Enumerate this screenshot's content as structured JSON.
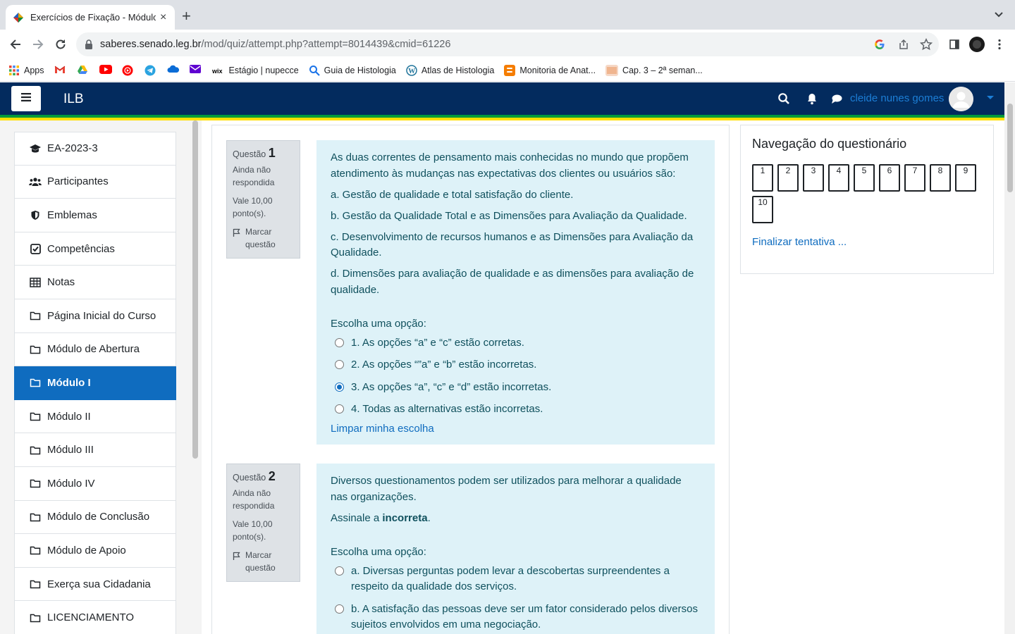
{
  "browser": {
    "tab_title": "Exercícios de Fixação - Módulo I",
    "tab_close": "×",
    "new_tab": "+",
    "url_host": "saberes.senado.leg.br",
    "url_path": "/mod/quiz/attempt.php?attempt=8014439&cmid=61226"
  },
  "bookmarks": {
    "apps": "Apps",
    "estagio": "Estágio | nupecce",
    "guia": "Guia de Histologia",
    "atlas": "Atlas de Histologia",
    "monitoria": "Monitoria de Anat...",
    "cap": "Cap. 3 – 2ª seman..."
  },
  "navbar": {
    "brand": "ILB",
    "username": "cleide nunes gomes"
  },
  "drawer": {
    "items": [
      {
        "label": "EA-2023-3",
        "icon": "graduation-cap-icon"
      },
      {
        "label": "Participantes",
        "icon": "users-icon"
      },
      {
        "label": "Emblemas",
        "icon": "shield-icon"
      },
      {
        "label": "Competências",
        "icon": "check-square-icon"
      },
      {
        "label": "Notas",
        "icon": "table-icon"
      },
      {
        "label": "Página Inicial do Curso",
        "icon": "folder-icon"
      },
      {
        "label": "Módulo de Abertura",
        "icon": "folder-icon"
      },
      {
        "label": "Módulo I",
        "icon": "folder-icon",
        "active": true
      },
      {
        "label": "Módulo II",
        "icon": "folder-icon"
      },
      {
        "label": "Módulo III",
        "icon": "folder-icon"
      },
      {
        "label": "Módulo IV",
        "icon": "folder-icon"
      },
      {
        "label": "Módulo de Conclusão",
        "icon": "folder-icon"
      },
      {
        "label": "Módulo de Apoio",
        "icon": "folder-icon"
      },
      {
        "label": "Exerça sua Cidadania",
        "icon": "folder-icon"
      },
      {
        "label": "LICENCIAMENTO",
        "icon": "folder-icon"
      }
    ]
  },
  "questions": [
    {
      "label": "Questão",
      "number": "1",
      "state": "Ainda não respondida",
      "grade": "Vale 10,00 ponto(s).",
      "flag": "Marcar questão",
      "text": "As duas correntes de pensamento mais conhecidas no mundo que propõem atendimento às mudanças nas expectativas dos clientes ou usuários são:",
      "statements": [
        "a. Gestão de qualidade e total satisfação do cliente.",
        "b. Gestão da Qualidade Total e as Dimensões para Avaliação da Qualidade.",
        "c. Desenvolvimento de recursos humanos e as Dimensões para Avaliação da Qualidade.",
        "d. Dimensões para avaliação de qualidade e as dimensões para avaliação de qualidade."
      ],
      "prompt": "Escolha uma opção:",
      "options": [
        {
          "text": "1. As opções “a” e “c” estão corretas.",
          "checked": false
        },
        {
          "text": "2. As opções “”a” e “b” estão incorretas.",
          "checked": false
        },
        {
          "text": "3. As opções “a”, “c” e “d” estão incorretas.",
          "checked": true
        },
        {
          "text": "4. Todas as alternativas estão incorretas.",
          "checked": false
        }
      ],
      "clear": "Limpar minha escolha"
    },
    {
      "label": "Questão",
      "number": "2",
      "state": "Ainda não respondida",
      "grade": "Vale 10,00 ponto(s).",
      "flag": "Marcar questão",
      "text": "Diversos questionamentos podem ser utilizados para melhorar a qualidade nas organizações.",
      "instruction_prefix": "Assinale a ",
      "instruction_bold": "incorreta",
      "instruction_suffix": ".",
      "prompt": "Escolha uma opção:",
      "options": [
        {
          "text": "a. Diversas perguntas podem levar a descobertas surpreendentes a respeito da qualidade dos serviços.",
          "checked": false
        },
        {
          "text": "b. A satisfação das pessoas deve ser um fator considerado pelos diversos sujeitos envolvidos em uma negociação.",
          "checked": false
        }
      ]
    }
  ],
  "quiz_nav": {
    "title": "Navegação do questionário",
    "buttons": [
      "1",
      "2",
      "3",
      "4",
      "5",
      "6",
      "7",
      "8",
      "9",
      "10"
    ],
    "finish": "Finalizar tentativa ..."
  }
}
